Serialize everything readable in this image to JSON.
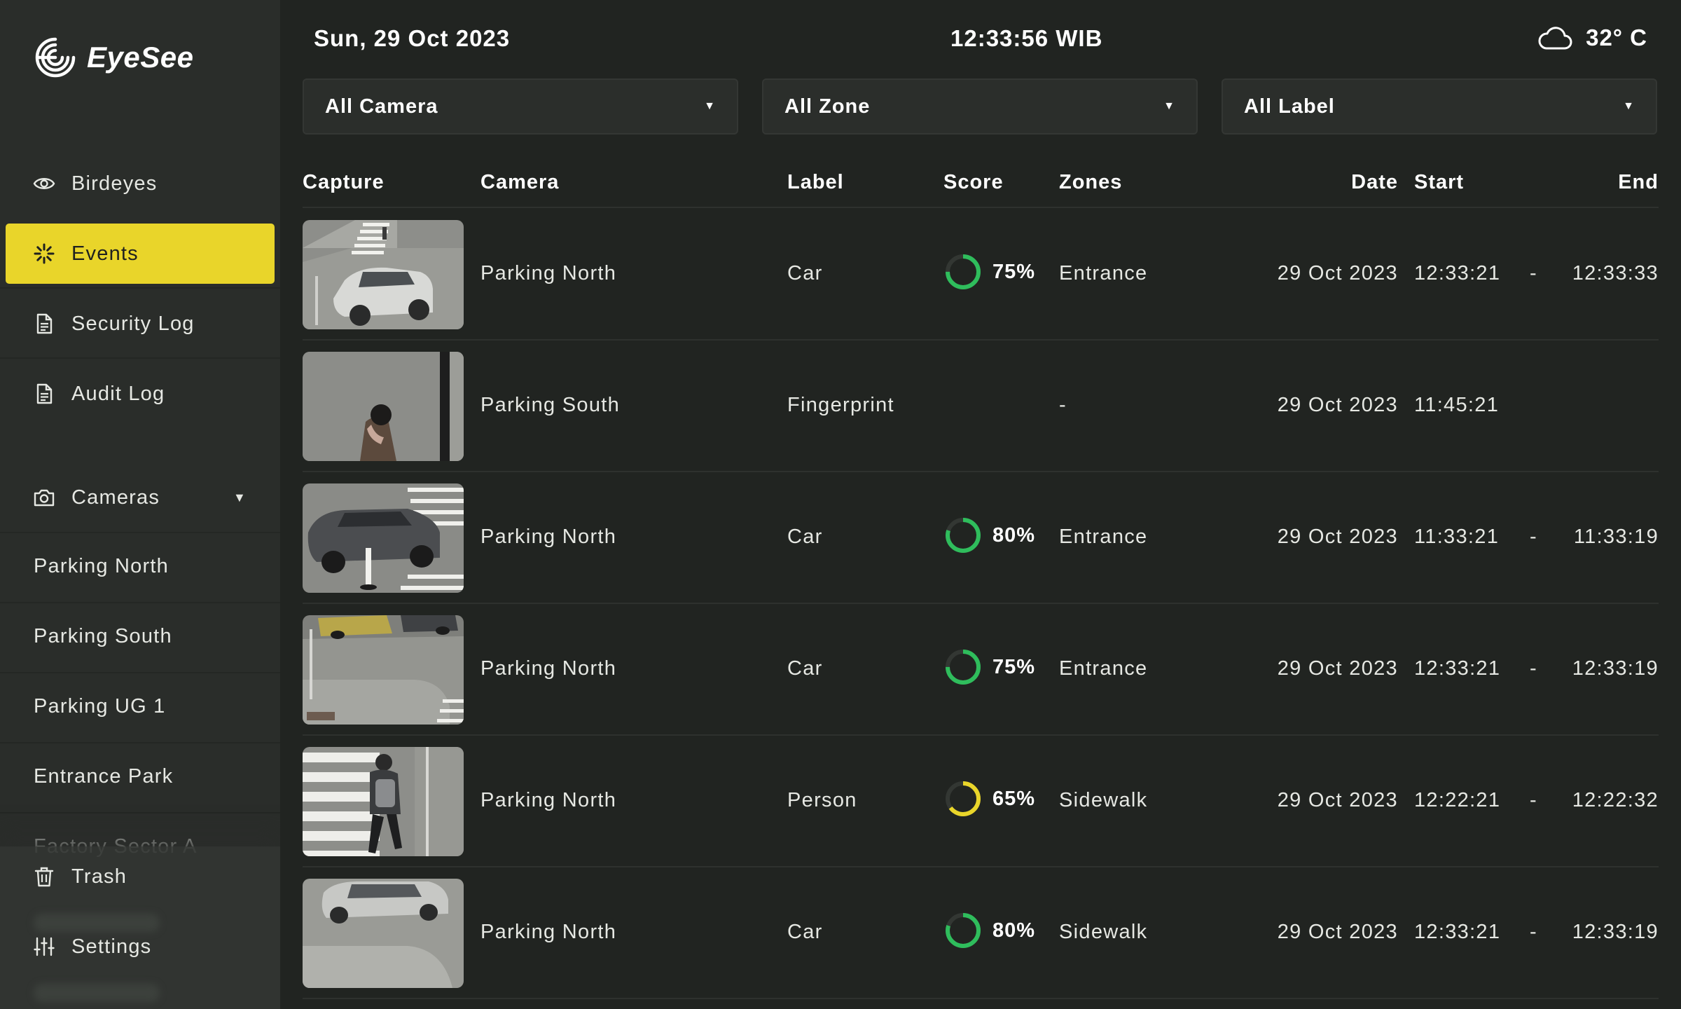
{
  "app": {
    "name": "EyeSee"
  },
  "sidebar": {
    "nav": [
      {
        "label": "Birdeyes",
        "icon": "eye-icon"
      },
      {
        "label": "Events",
        "icon": "burst-icon",
        "active": true
      },
      {
        "label": "Security Log",
        "icon": "document-icon"
      },
      {
        "label": "Audit Log",
        "icon": "document-icon"
      }
    ],
    "cameras_label": "Cameras",
    "cameras": [
      "Parking North",
      "Parking South",
      "Parking UG 1",
      "Entrance Park",
      "Factory Sector A"
    ],
    "bottom": [
      {
        "label": "Trash",
        "icon": "trash-icon"
      },
      {
        "label": "Settings",
        "icon": "sliders-icon"
      }
    ]
  },
  "topbar": {
    "date": "Sun, 29 Oct 2023",
    "time": "12:33:56 WIB",
    "temperature": "32° C",
    "weather_icon": "cloud-icon"
  },
  "filters": [
    {
      "value": "All Camera"
    },
    {
      "value": "All Zone"
    },
    {
      "value": "All Label"
    }
  ],
  "table": {
    "headers": {
      "capture": "Capture",
      "camera": "Camera",
      "label": "Label",
      "score": "Score",
      "zones": "Zones",
      "date": "Date",
      "start": "Start",
      "end": "End"
    },
    "rows": [
      {
        "camera": "Parking North",
        "label": "Car",
        "score": "75%",
        "score_value": 0.75,
        "score_color": "#2fbd5c",
        "zones": "Entrance",
        "date": "29 Oct 2023",
        "start": "12:33:21",
        "sep": "-",
        "end": "12:33:33"
      },
      {
        "camera": "Parking South",
        "label": "Fingerprint",
        "score": "",
        "score_value": null,
        "zones": "-",
        "date": "29 Oct 2023",
        "start": "11:45:21",
        "sep": "",
        "end": ""
      },
      {
        "camera": "Parking North",
        "label": "Car",
        "score": "80%",
        "score_value": 0.8,
        "score_color": "#2fbd5c",
        "zones": "Entrance",
        "date": "29 Oct 2023",
        "start": "11:33:21",
        "sep": "-",
        "end": "11:33:19"
      },
      {
        "camera": "Parking North",
        "label": "Car",
        "score": "75%",
        "score_value": 0.75,
        "score_color": "#2fbd5c",
        "zones": "Entrance",
        "date": "29 Oct 2023",
        "start": "12:33:21",
        "sep": "-",
        "end": "12:33:19"
      },
      {
        "camera": "Parking North",
        "label": "Person",
        "score": "65%",
        "score_value": 0.65,
        "score_color": "#e9d52a",
        "zones": "Sidewalk",
        "date": "29 Oct 2023",
        "start": "12:22:21",
        "sep": "-",
        "end": "12:22:32"
      },
      {
        "camera": "Parking North",
        "label": "Car",
        "score": "80%",
        "score_value": 0.8,
        "score_color": "#2fbd5c",
        "zones": "Sidewalk",
        "date": "29 Oct 2023",
        "start": "12:33:21",
        "sep": "-",
        "end": "12:33:19"
      }
    ]
  },
  "colors": {
    "accent": "#e9d52a",
    "good": "#2fbd5c",
    "bg": "#212421",
    "sidebar": "#2a2d2a"
  }
}
